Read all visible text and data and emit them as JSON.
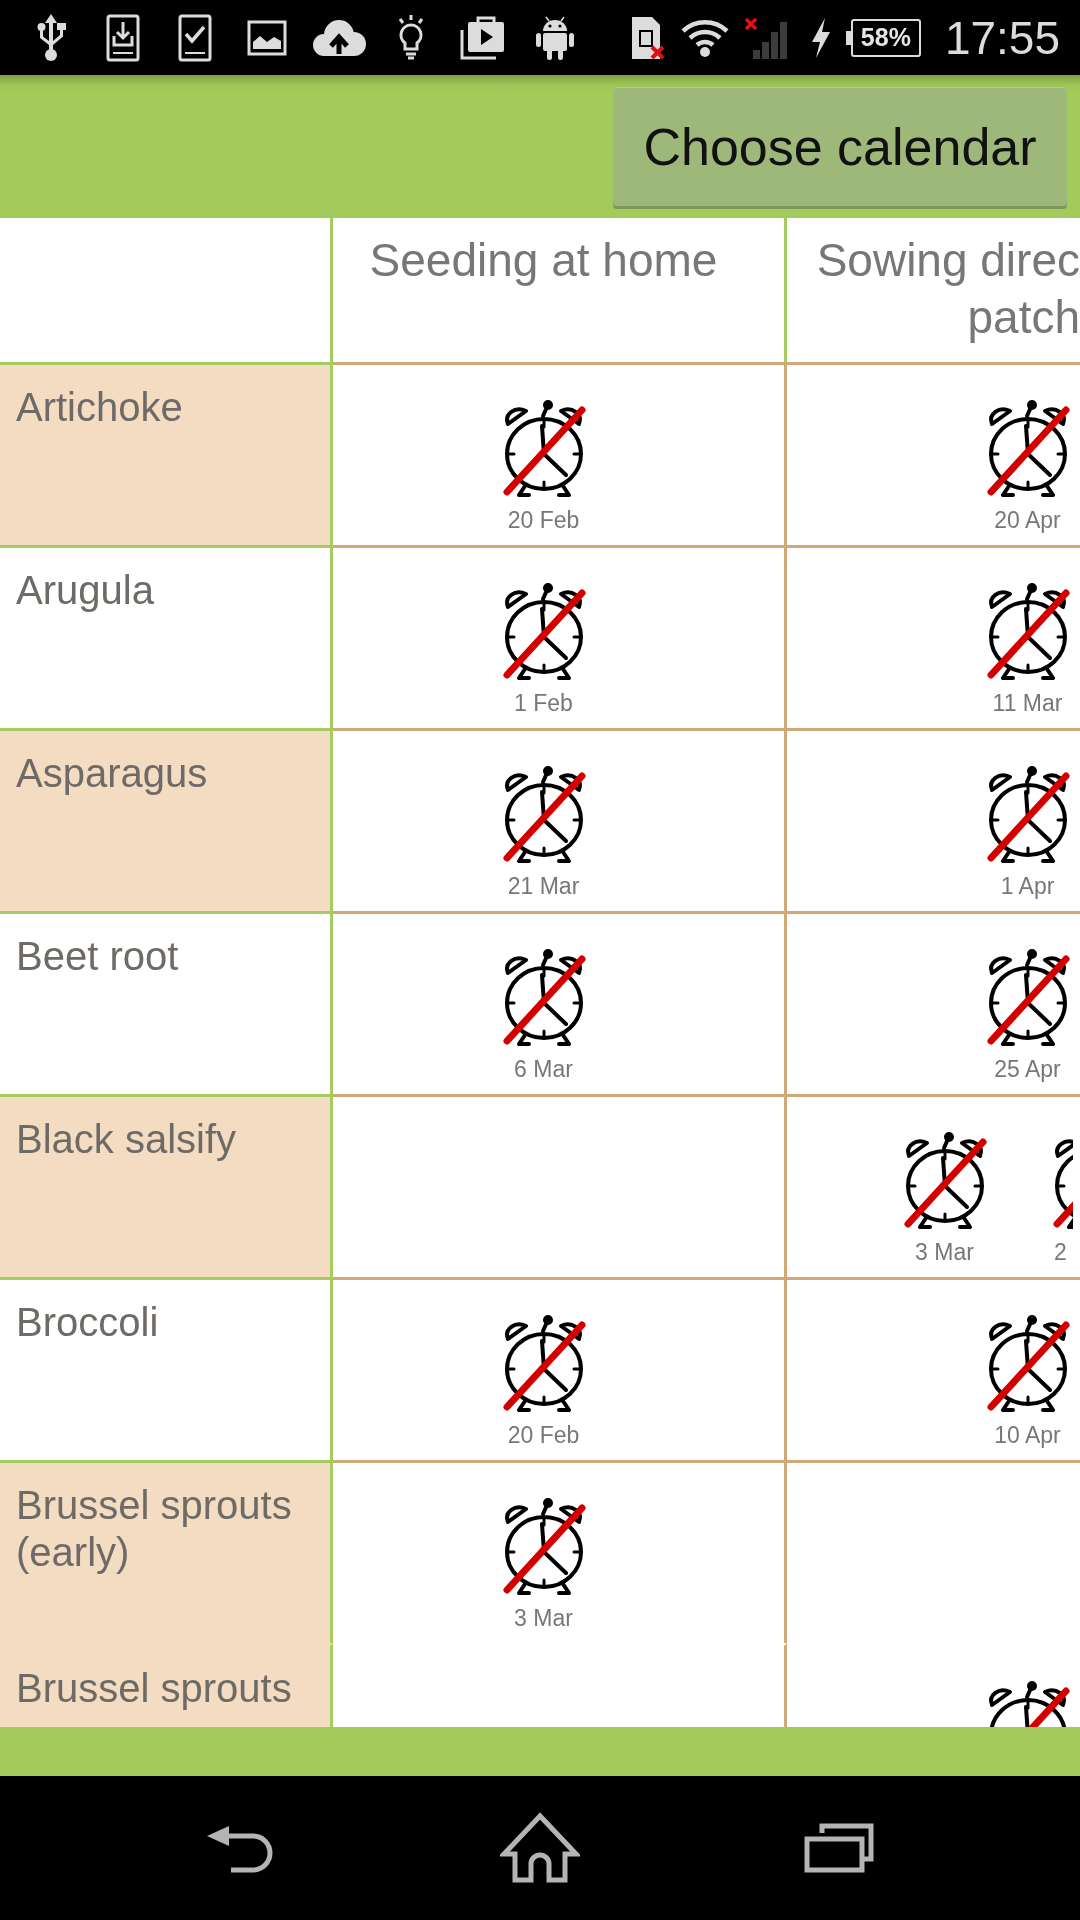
{
  "status_bar": {
    "battery": "58%",
    "time": "17:55"
  },
  "app_bar": {
    "button": "Choose calendar"
  },
  "table": {
    "columns": [
      "Seeding at home",
      "Sowing direc\npatch"
    ],
    "rows": [
      {
        "label": "Artichoke",
        "shaded": true,
        "separated": true,
        "cells": [
          {
            "kind": "alarms",
            "entries": [
              {
                "alarm_on": false,
                "date": "20 Feb"
              }
            ]
          },
          {
            "kind": "alarms",
            "entries": [
              {
                "alarm_on": false,
                "date": "20 Apr"
              }
            ]
          }
        ]
      },
      {
        "label": "Arugula",
        "shaded": false,
        "separated": true,
        "cells": [
          {
            "kind": "alarms",
            "entries": [
              {
                "alarm_on": false,
                "date": "1 Feb"
              }
            ]
          },
          {
            "kind": "alarms",
            "entries": [
              {
                "alarm_on": false,
                "date": "11 Mar"
              }
            ]
          }
        ]
      },
      {
        "label": "Asparagus",
        "shaded": true,
        "separated": true,
        "cells": [
          {
            "kind": "alarms",
            "entries": [
              {
                "alarm_on": false,
                "date": "21 Mar"
              }
            ]
          },
          {
            "kind": "alarms",
            "entries": [
              {
                "alarm_on": false,
                "date": "1 Apr"
              }
            ]
          }
        ]
      },
      {
        "label": "Beet root",
        "shaded": false,
        "separated": true,
        "cells": [
          {
            "kind": "alarms",
            "entries": [
              {
                "alarm_on": false,
                "date": "6 Mar"
              }
            ]
          },
          {
            "kind": "alarms",
            "entries": [
              {
                "alarm_on": false,
                "date": "25 Apr"
              }
            ]
          }
        ]
      },
      {
        "label": "Black salsify",
        "shaded": true,
        "separated": true,
        "cells": [
          {
            "kind": "blank"
          },
          {
            "kind": "alarms",
            "entries": [
              {
                "alarm_on": false,
                "date": "3 Mar"
              },
              {
                "alarm_on": false,
                "date": "2"
              }
            ]
          }
        ]
      },
      {
        "label": "Broccoli",
        "shaded": false,
        "separated": true,
        "cells": [
          {
            "kind": "alarms",
            "entries": [
              {
                "alarm_on": false,
                "date": "20 Feb"
              }
            ]
          },
          {
            "kind": "alarms",
            "entries": [
              {
                "alarm_on": false,
                "date": "10 Apr"
              }
            ]
          }
        ]
      },
      {
        "label": "Brussel sprouts (early)",
        "shaded": true,
        "separated": true,
        "cells": [
          {
            "kind": "alarms",
            "entries": [
              {
                "alarm_on": false,
                "date": "3 Mar"
              }
            ]
          },
          {
            "kind": "blank"
          }
        ]
      },
      {
        "label": "Brussel sprouts",
        "shaded": true,
        "separated": false,
        "cells": [
          {
            "kind": "blank"
          },
          {
            "kind": "alarms",
            "entries": [
              {
                "alarm_on": false
              }
            ]
          }
        ]
      }
    ]
  }
}
